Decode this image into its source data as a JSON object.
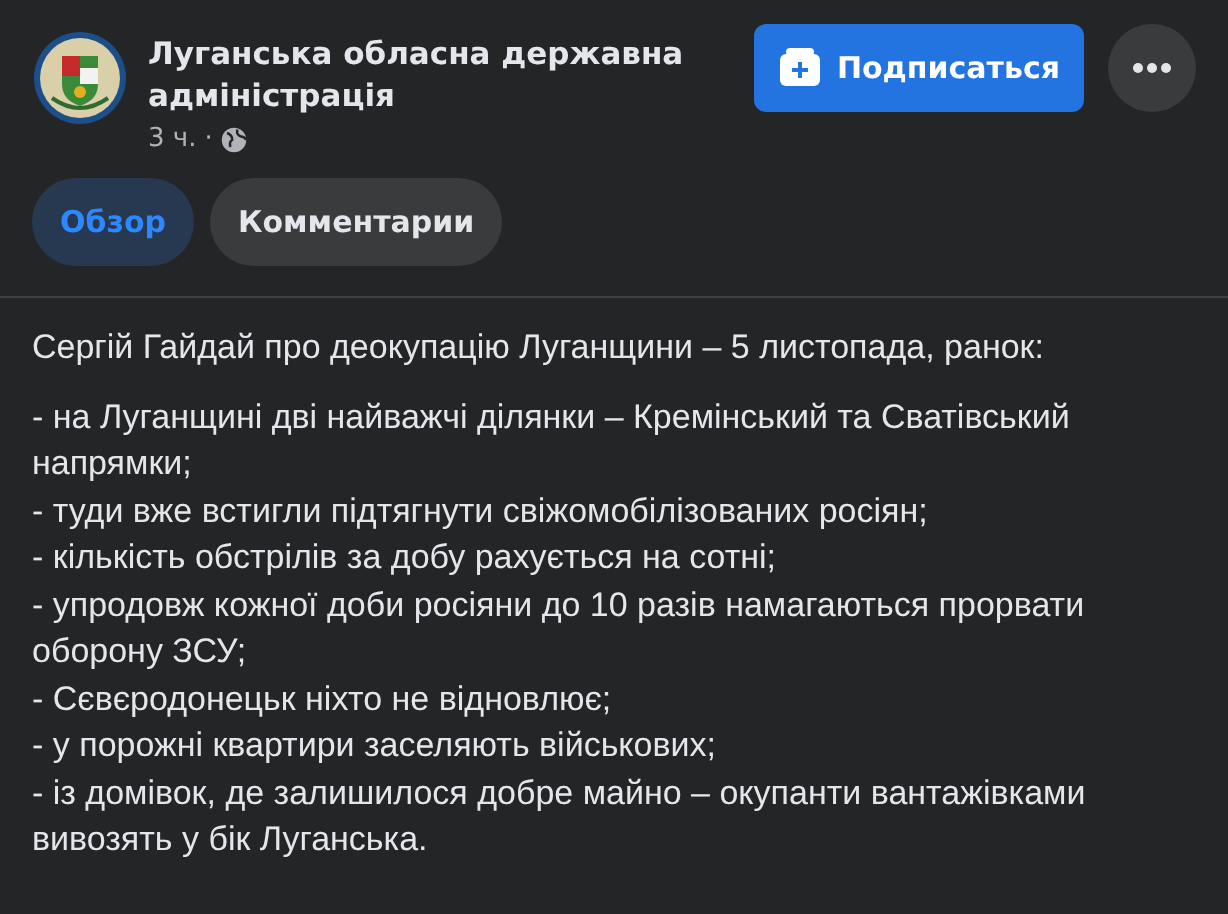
{
  "page": {
    "name": "Луганська обласна державна адміністрація",
    "time": "3 ч.",
    "separator": "·"
  },
  "follow_button": {
    "label": "Подписаться"
  },
  "tabs": [
    {
      "label": "Обзор",
      "selected": true
    },
    {
      "label": "Комментарии",
      "selected": false
    }
  ],
  "post": {
    "intro": "Сергій Гайдай про деокупацію Луганщини – 5 листопада, ранок:",
    "items": [
      "- на Луганщині дві найважчі ділянки – Кремінський та Сватівський напрямки;",
      "- туди вже встигли підтягнути свіжомобілізованих росіян;",
      "- кількість обстрілів за добу рахується на сотні;",
      "- упродовж кожної доби росіяни до 10 разів намагаються прорвати оборону ЗСУ;",
      "- Сєвєродонецьк ніхто не відновлює;",
      "- у порожні квартири заселяють військових;",
      "- із домівок, де залишилося добре майно – окупанти вантажівками вивозять у бік Луганська."
    ]
  }
}
